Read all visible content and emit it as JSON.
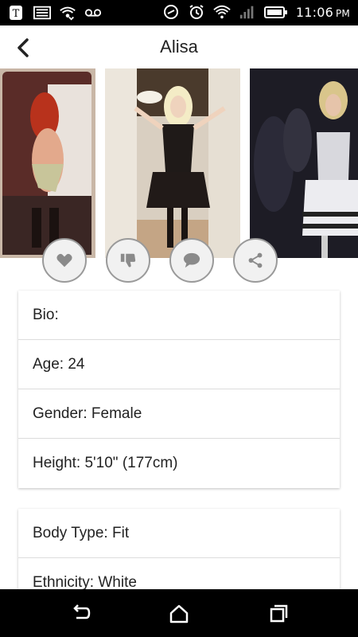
{
  "status_bar": {
    "time": "11:06",
    "ampm": "PM",
    "left_icons": [
      "tmobile-icon",
      "image-icon",
      "wifi-calling-icon",
      "voicemail-icon"
    ],
    "right_icons": [
      "nfc-icon",
      "alarm-icon",
      "wifi-icon",
      "signal-icon",
      "battery-icon"
    ]
  },
  "header": {
    "title": "Alisa"
  },
  "gallery": {
    "photos": [
      "photo-1",
      "photo-2",
      "photo-3"
    ]
  },
  "actions": [
    "like",
    "dislike",
    "message",
    "share"
  ],
  "profile": {
    "bio": "Bio:",
    "age": "Age: 24",
    "gender": "Gender: Female",
    "height": "Height: 5'10\" (177cm)",
    "body_type": "Body Type: Fit",
    "ethnicity": "Ethnicity: White"
  },
  "colors": {
    "status_bar": "#000000",
    "background": "#ffffff",
    "action_border": "#9a9a9a",
    "action_icon": "#8a8a8a",
    "nav_bar": "#000000"
  }
}
